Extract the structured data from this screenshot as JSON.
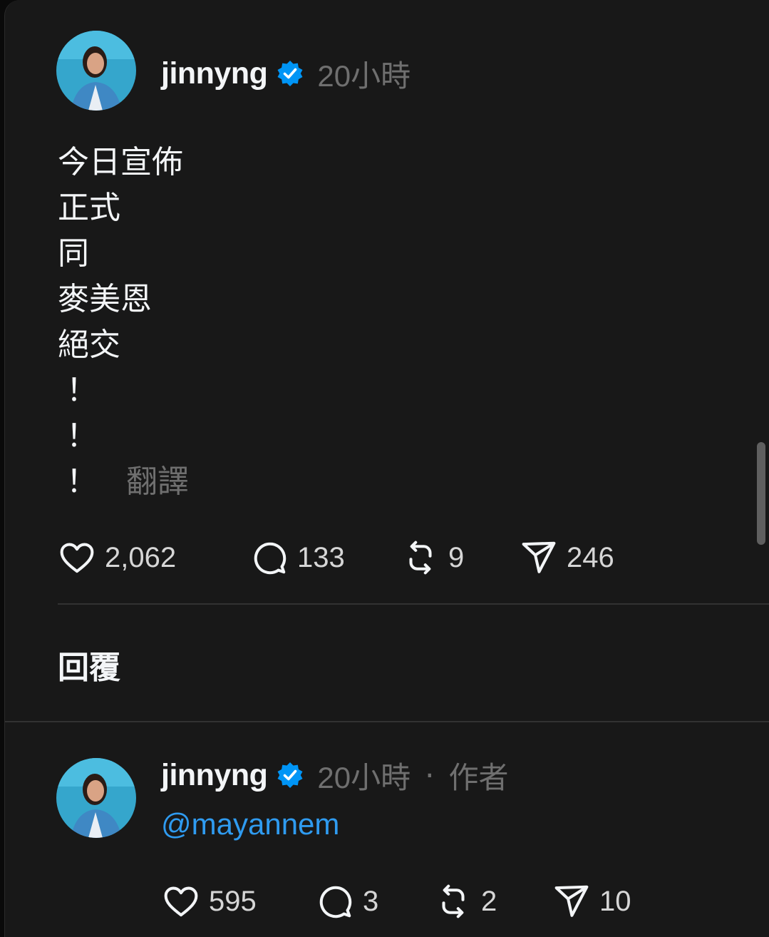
{
  "colors": {
    "background": "#181818",
    "text": "#f3f5f7",
    "muted": "#6f6f6f",
    "accent": "#2f9bf0",
    "verified": "#0095f6"
  },
  "post": {
    "username": "jinnyng",
    "time": "20小時",
    "body_lines": [
      "今日宣佈",
      "正式",
      "同",
      "麥美恩",
      "絕交",
      "！",
      "！",
      "！"
    ],
    "translate_label": "翻譯",
    "actions": {
      "like_icon": "heart-icon",
      "likes": "2,062",
      "comment_icon": "comment-icon",
      "comments": "133",
      "repost_icon": "repost-icon",
      "reposts": "9",
      "share_icon": "share-icon",
      "shares": "246"
    }
  },
  "replies_heading": "回覆",
  "reply": {
    "username": "jinnyng",
    "time": "20小時",
    "separator": "·",
    "author_label": "作者",
    "mention": "@mayannem",
    "actions": {
      "likes": "595",
      "comments": "3",
      "reposts": "2",
      "shares": "10"
    }
  }
}
